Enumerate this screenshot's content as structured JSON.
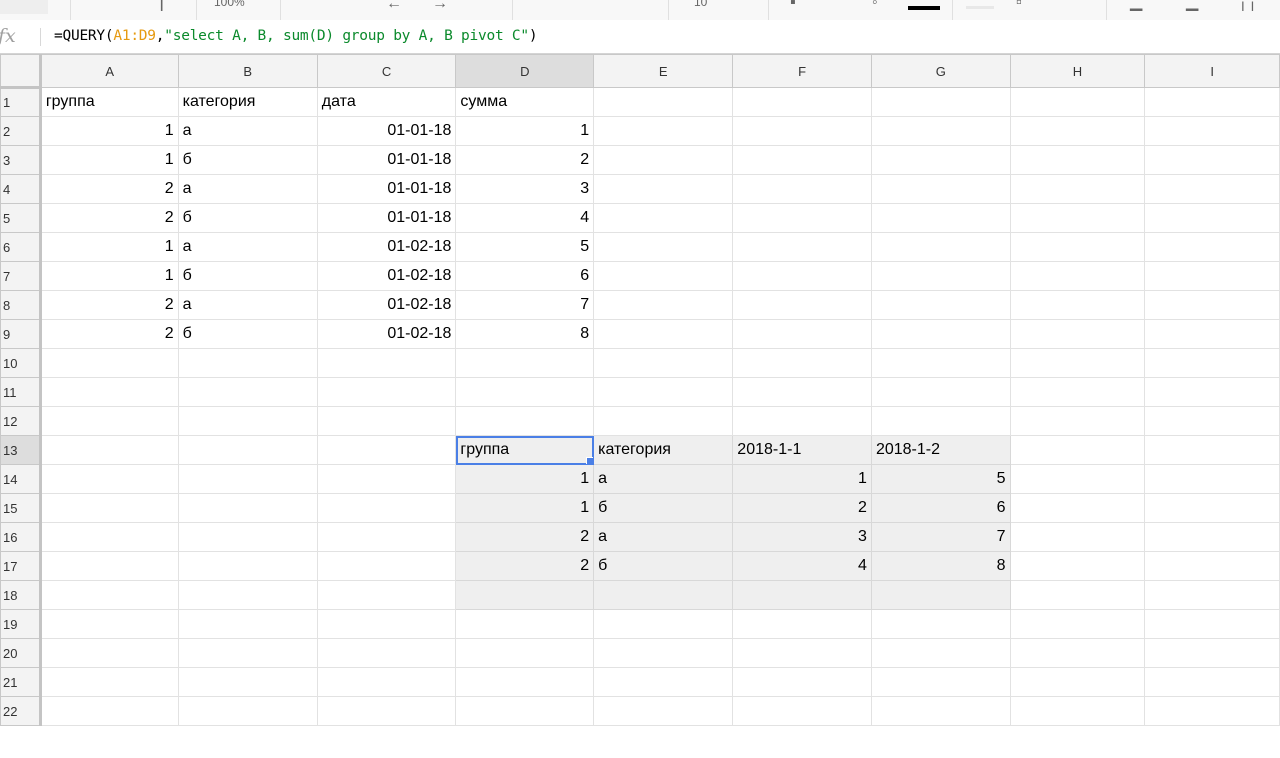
{
  "toolbar": {
    "undo_icon": "undo-arrow-icon",
    "redo_icon": "redo-arrow-icon",
    "zoom_partial": "100%",
    "font_size_partial": "10",
    "text_color": "#000000"
  },
  "formula_bar": {
    "fx_label": "fx",
    "formula_prefix": "=QUERY(",
    "formula_range": "A1:D9",
    "formula_comma": ",",
    "formula_string": "\"select A, B, sum(D) group by A, B pivot C\"",
    "formula_suffix": ")",
    "range_color": "#e69a10",
    "string_color": "#0b8a2c"
  },
  "grid": {
    "columns": [
      "A",
      "B",
      "C",
      "D",
      "E",
      "F",
      "G",
      "H",
      "I"
    ],
    "row_numbers": [
      "1",
      "2",
      "3",
      "4",
      "5",
      "6",
      "7",
      "8",
      "9",
      "10",
      "11",
      "12",
      "13",
      "14",
      "15",
      "16",
      "17",
      "18",
      "19",
      "20",
      "21",
      "22"
    ],
    "selected_cell": "D13",
    "selection_color": "#4a7fe6",
    "source_table": {
      "headers": [
        "группа",
        "категория",
        "дата",
        "сумма"
      ],
      "rows": [
        [
          "1",
          "а",
          "01-01-18",
          "1"
        ],
        [
          "1",
          "б",
          "01-01-18",
          "2"
        ],
        [
          "2",
          "а",
          "01-01-18",
          "3"
        ],
        [
          "2",
          "б",
          "01-01-18",
          "4"
        ],
        [
          "1",
          "а",
          "01-02-18",
          "5"
        ],
        [
          "1",
          "б",
          "01-02-18",
          "6"
        ],
        [
          "2",
          "а",
          "01-02-18",
          "7"
        ],
        [
          "2",
          "б",
          "01-02-18",
          "8"
        ]
      ]
    },
    "pivot_table": {
      "headers": [
        "группа",
        "категория",
        "2018-1-1",
        "2018-1-2"
      ],
      "rows": [
        [
          "1",
          "а",
          "1",
          "5"
        ],
        [
          "1",
          "б",
          "2",
          "6"
        ],
        [
          "2",
          "а",
          "3",
          "7"
        ],
        [
          "2",
          "б",
          "4",
          "8"
        ]
      ]
    }
  }
}
